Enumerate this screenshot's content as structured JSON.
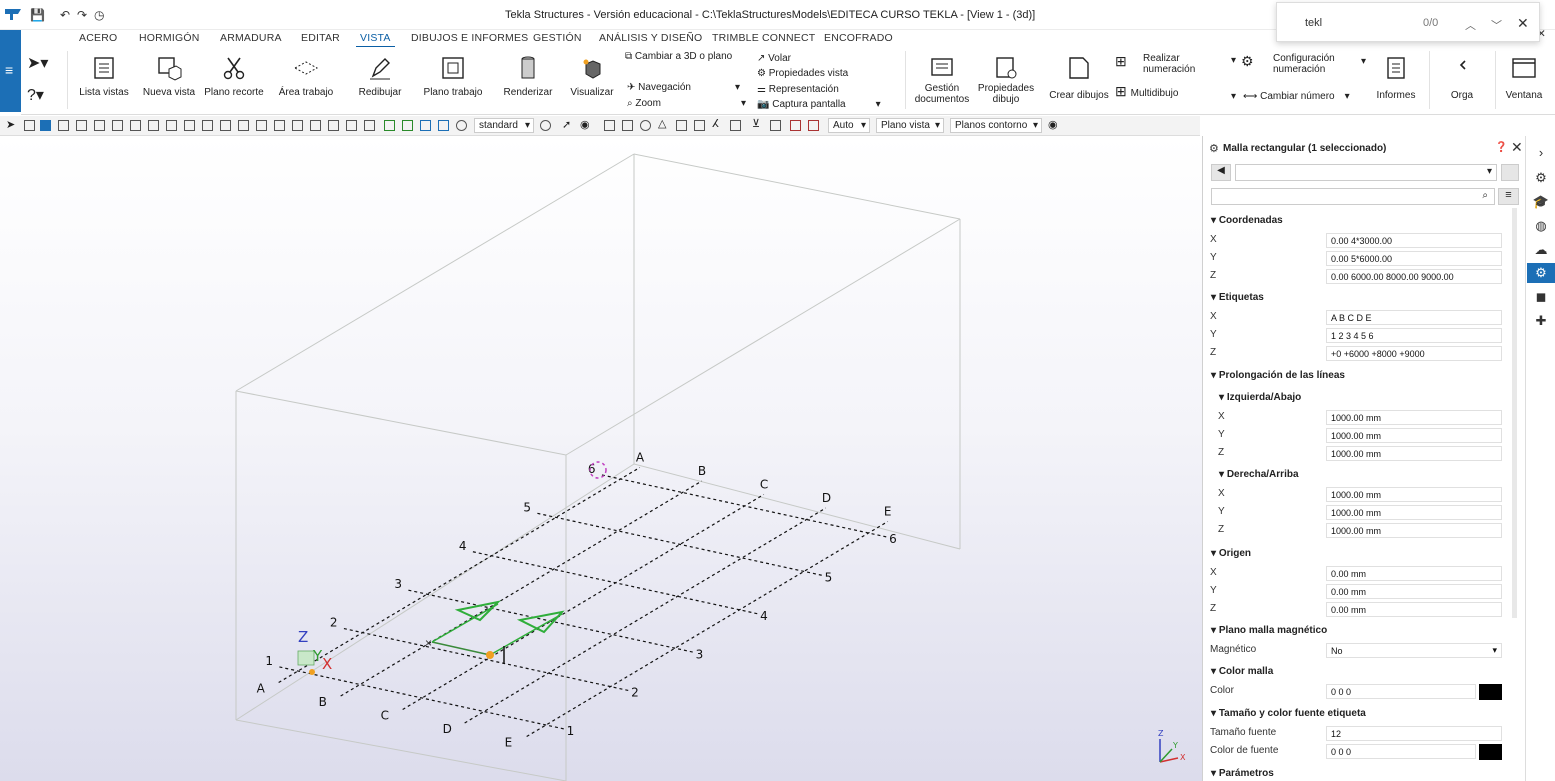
{
  "title_bar": {
    "title": "Tekla Structures - Versión educacional - C:\\TeklaStructuresModels\\EDITECA CURSO TEKLA  - [View 1 - (3d)]"
  },
  "search": {
    "value": "tekl",
    "count": "0/0"
  },
  "tabs": [
    "ACERO",
    "HORMIGÓN",
    "ARMADURA",
    "EDITAR",
    "VISTA",
    "DIBUJOS E INFORMES",
    "GESTIÓN",
    "ANÁLISIS Y DISEÑO",
    "TRIMBLE CONNECT",
    "ENCOFRADO"
  ],
  "active_tab": "VISTA",
  "ribbon": {
    "lista_vistas": "Lista vistas",
    "nueva_vista": "Nueva vista",
    "plano_recorte": "Plano recorte",
    "area_trabajo": "Área trabajo",
    "redibujar": "Redibujar",
    "plano_trabajo": "Plano trabajo",
    "renderizar": "Renderizar",
    "visualizar": "Visualizar",
    "cambiar_3d": "Cambiar a 3D o plano",
    "navegacion": "Navegación",
    "zoom": "Zoom",
    "volar": "Volar",
    "propiedades_vista": "Propiedades vista",
    "representacion": "Representación",
    "captura": "Captura pantalla",
    "gestion_1": "Gestión",
    "gestion_2": "documentos",
    "prop_dibujo_1": "Propiedades",
    "prop_dibujo_2": "dibujo",
    "crear_dibujos": "Crear dibujos",
    "realizar_1": "Realizar",
    "realizar_2": "numeración",
    "multidibujo": "Multidibujo",
    "config_1": "Configuración",
    "config_2": "numeración",
    "cambiar_numero": "Cambiar número",
    "informes": "Informes",
    "orga": "Orga",
    "ventana": "Ventana"
  },
  "toolbar": {
    "standard": "standard",
    "auto": "Auto",
    "plano_vista": "Plano vista",
    "planos_contorno": "Planos contorno"
  },
  "panel": {
    "title": "Malla rectangular (1 seleccionado)",
    "coordenadas": "Coordenadas",
    "coord": {
      "x": "0.00 4*3000.00",
      "y": "0.00 5*6000.00",
      "z": "0.00 6000.00 8000.00 9000.00"
    },
    "etiquetas": "Etiquetas",
    "etiq": {
      "x": "A B C D E",
      "y": "1 2 3 4 5 6",
      "z": "+0 +6000 +8000 +9000"
    },
    "prolongacion": "Prolongación de las líneas",
    "izq": "Izquierda/Abajo",
    "izq_vals": {
      "x": "1000.00 mm",
      "y": "1000.00 mm",
      "z": "1000.00 mm"
    },
    "der": "Derecha/Arriba",
    "der_vals": {
      "x": "1000.00 mm",
      "y": "1000.00 mm",
      "z": "1000.00 mm"
    },
    "origen": "Origen",
    "origen_vals": {
      "x": "0.00 mm",
      "y": "0.00 mm",
      "z": "0.00 mm"
    },
    "plano_magnetico": "Plano malla magnético",
    "magnetico_label": "Magnético",
    "magnetico_val": "No",
    "color_malla": "Color malla",
    "color_label": "Color",
    "color_val": "0 0 0",
    "tamano": "Tamaño y color fuente etiqueta",
    "tam_fuente_label": "Tamaño fuente",
    "tam_fuente_val": "12",
    "color_fuente_label": "Color de fuente",
    "color_fuente_val": "0 0 0",
    "parametros": "Parámetros",
    "axis_labels": {
      "x": "X",
      "y": "Y",
      "z": "Z"
    }
  },
  "viewport": {
    "col_labels": [
      "A",
      "B",
      "C",
      "D",
      "E"
    ],
    "row_labels": [
      "1",
      "2",
      "3",
      "4",
      "5",
      "6"
    ],
    "axis": {
      "x": "X",
      "y": "Y",
      "z": "Z"
    }
  },
  "colors": {
    "accent": "#1c6fb6",
    "grid_line": "#111111",
    "arrow": "#2fae3a",
    "box": "#b9bcb9"
  }
}
